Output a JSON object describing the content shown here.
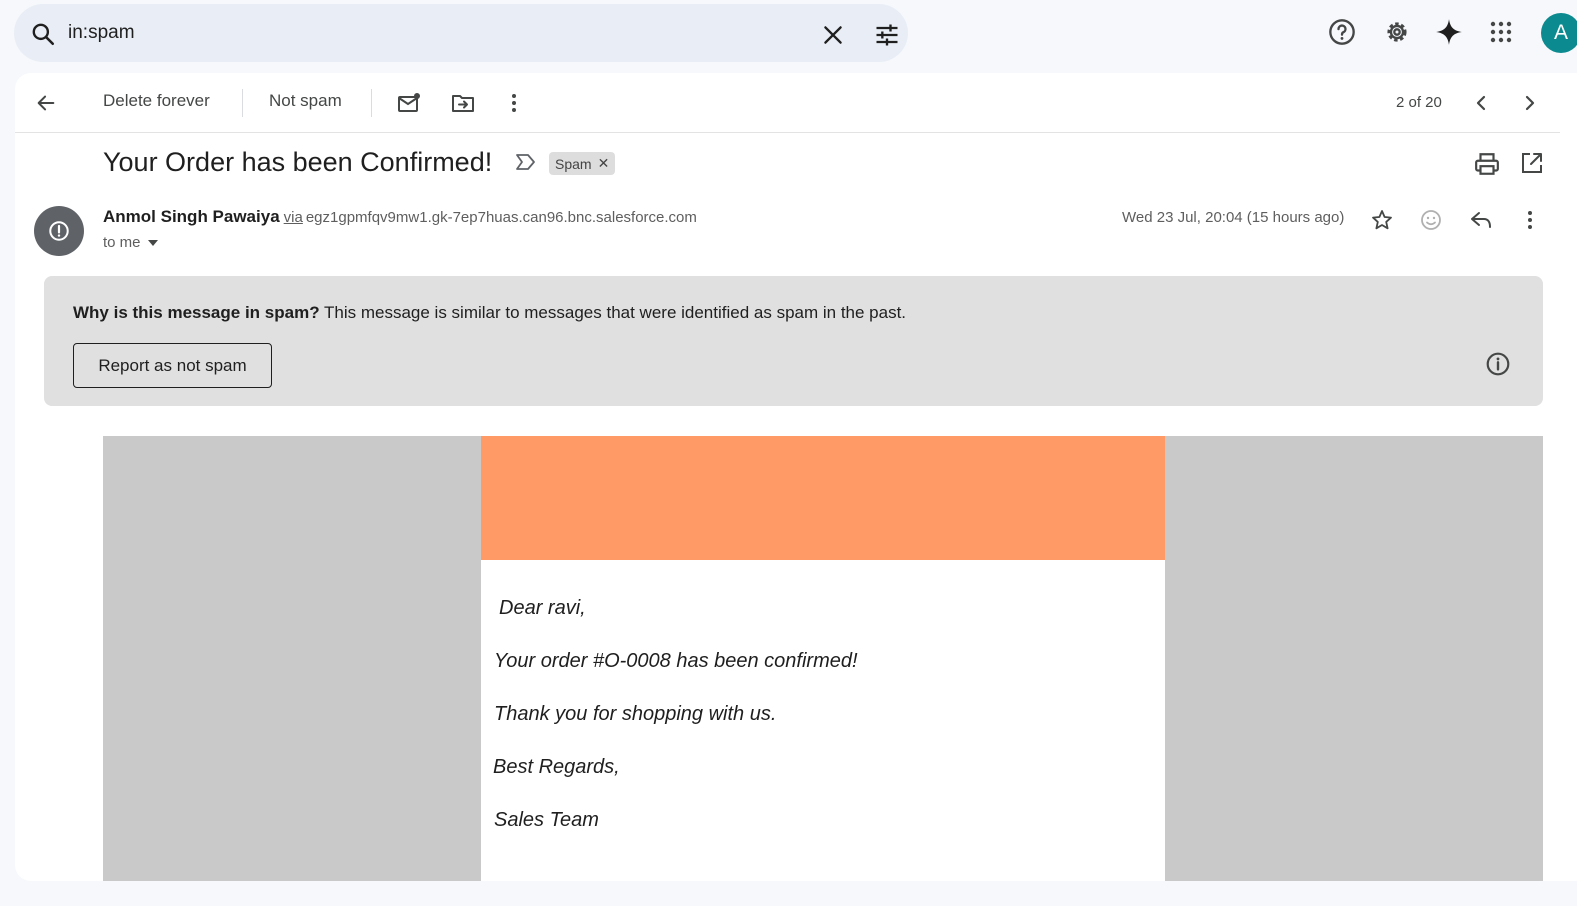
{
  "search": {
    "value": "in:spam"
  },
  "toolbar": {
    "delete_forever": "Delete forever",
    "not_spam": "Not spam",
    "pager": "2 of 20"
  },
  "avatar": {
    "initial": "A"
  },
  "message": {
    "subject": "Your Order has been Confirmed!",
    "label": "Spam",
    "sender_name": "Anmol Singh Pawaiya",
    "via": "via",
    "via_address": "egz1gpmfqv9mw1.gk-7ep7huas.can96.bnc.salesforce.com",
    "to": "to me",
    "date": "Wed 23 Jul, 20:04 (15 hours ago)"
  },
  "spam_notice": {
    "question": "Why is this message in spam?",
    "reason": "This message is similar to messages that were identified as spam in the past.",
    "button": "Report as not spam"
  },
  "body": {
    "greeting": "Dear ravi,",
    "order_line": "Your order #O-0008 has been confirmed!",
    "thanks": "Thank you for shopping with us.",
    "regards": "Best Regards,",
    "signature": "Sales Team",
    "banner_color": "#ff9966"
  }
}
